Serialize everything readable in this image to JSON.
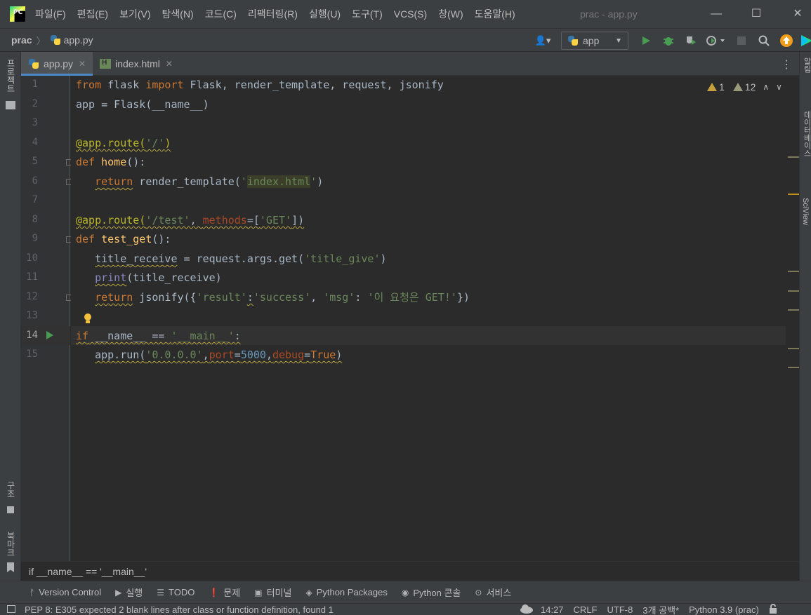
{
  "menubar": {
    "logo_text": "PC",
    "items": [
      "파일(F)",
      "편집(E)",
      "보기(V)",
      "탐색(N)",
      "코드(C)",
      "리팩터링(R)",
      "실행(U)",
      "도구(T)",
      "VCS(S)",
      "창(W)",
      "도움말(H)"
    ],
    "window_title": "prac - app.py",
    "minimize": "—",
    "maximize": "☐",
    "close": "✕"
  },
  "navbar": {
    "project": "prac",
    "separator": "〉",
    "file": "app.py",
    "run_config": "app",
    "run_config_arrow": "▼",
    "user_icon": "👤▾"
  },
  "left_strip": {
    "project_label": "프로젝트",
    "structure_label": "구조",
    "bookmarks_label": "북마크"
  },
  "right_strip": {
    "notifications_label": "알림",
    "database_label": "데이터베이스",
    "sciview_label": "SciView"
  },
  "tabs": [
    {
      "label": "app.py",
      "close": "✕"
    },
    {
      "label": "index.html",
      "close": "✕"
    }
  ],
  "tab_menu": "⋮",
  "inspections": {
    "warnings": "1",
    "weak_warnings": "12",
    "up": "∧",
    "down": "∨"
  },
  "line_numbers": [
    "1",
    "2",
    "3",
    "4",
    "5",
    "6",
    "7",
    "8",
    "9",
    "10",
    "11",
    "12",
    "13",
    "14",
    "15"
  ],
  "current_line": "14",
  "code": {
    "l1": {
      "kw1": "from",
      "t1": " flask ",
      "kw2": "import",
      "t2": " Flask, render_template, request, jsonify"
    },
    "l2": {
      "t1": "app = Flask(__name__)"
    },
    "l4": {
      "deco": "@app.route(",
      "str": "'/'",
      "deco2": ")"
    },
    "l5": {
      "kw": "def",
      "sp": " ",
      "fn": "home",
      "t": "():"
    },
    "l6": {
      "indent": "   ",
      "kw": "return",
      "t1": " render_template(",
      "q1": "'",
      "hl": "index.html",
      "q2": "'",
      "t2": ")"
    },
    "l8": {
      "deco": "@app.route(",
      "str": "'/test'",
      "c": ", ",
      "param": "methods",
      "eq": "=[",
      "str2": "'GET'",
      "end": "])"
    },
    "l9": {
      "kw": "def",
      "sp": " ",
      "fn": "test_get",
      "t": "():"
    },
    "l10": {
      "indent": "   ",
      "var": "title_receive",
      "t1": " = request.args.get(",
      "str": "'title_give'",
      "t2": ")"
    },
    "l11": {
      "indent": "   ",
      "builtin": "print",
      "t": "(title_receive)"
    },
    "l12": {
      "indent": "   ",
      "kw": "return",
      "t1": " jsonify({",
      "s1": "'result'",
      "colon": ":",
      "s2": "'success'",
      "c": ", ",
      "s3": "'msg'",
      "colon2": ": ",
      "s4": "'이 요청은 GET!'",
      "t2": "})"
    },
    "l14": {
      "kw": "if",
      "t1": " __name__ == ",
      "str": "'__main__'",
      "t2": ":"
    },
    "l15": {
      "indent": "   ",
      "t1": "app.run(",
      "str": "'0.0.0.0'",
      "c1": ",",
      "p1": "port",
      "eq1": "=",
      "num": "5000",
      "c2": ",",
      "p2": "debug",
      "eq2": "=",
      "kw": "True",
      "t2": ")"
    }
  },
  "code_breadcrumb": "if __name__ == '__main__'",
  "tool_windows": [
    {
      "icon": "ᚠ",
      "label": "Version Control"
    },
    {
      "icon": "▶",
      "label": "실행"
    },
    {
      "icon": "☰",
      "label": "TODO"
    },
    {
      "icon": "❗",
      "label": "문제"
    },
    {
      "icon": "▣",
      "label": "터미널"
    },
    {
      "icon": "◈",
      "label": "Python Packages"
    },
    {
      "icon": "◉",
      "label": "Python 콘솔"
    },
    {
      "icon": "⊙",
      "label": "서비스"
    }
  ],
  "status": {
    "message": "PEP 8: E305 expected 2 blank lines after class or function definition, found 1",
    "position": "14:27",
    "line_sep": "CRLF",
    "encoding": "UTF-8",
    "indent": "3개 공백*",
    "interpreter": "Python 3.9 (prac)"
  }
}
